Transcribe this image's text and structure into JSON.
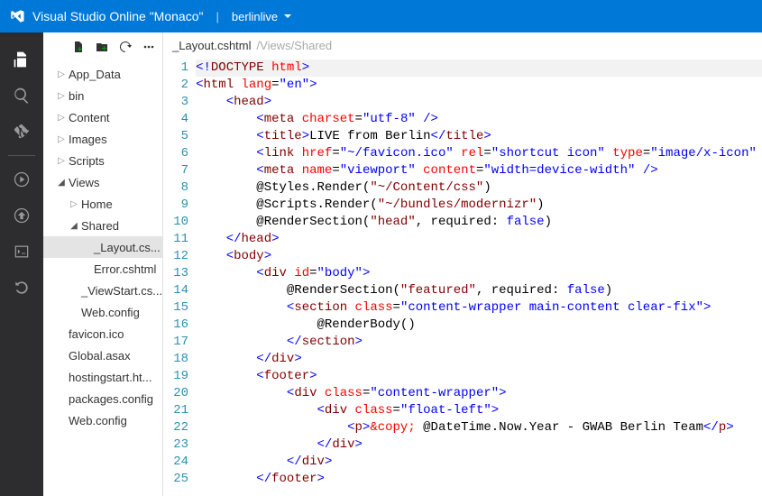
{
  "header": {
    "app_title": "Visual Studio Online \"Monaco\"",
    "project": "berlinlive"
  },
  "tree": {
    "items": [
      {
        "label": "App_Data",
        "indent": 1,
        "arrow": "closed"
      },
      {
        "label": "bin",
        "indent": 1,
        "arrow": "closed"
      },
      {
        "label": "Content",
        "indent": 1,
        "arrow": "closed"
      },
      {
        "label": "Images",
        "indent": 1,
        "arrow": "closed"
      },
      {
        "label": "Scripts",
        "indent": 1,
        "arrow": "closed"
      },
      {
        "label": "Views",
        "indent": 1,
        "arrow": "open"
      },
      {
        "label": "Home",
        "indent": 2,
        "arrow": "closed"
      },
      {
        "label": "Shared",
        "indent": 2,
        "arrow": "open"
      },
      {
        "label": "_Layout.cs...",
        "indent": 3,
        "arrow": "none",
        "selected": true
      },
      {
        "label": "Error.cshtml",
        "indent": 3,
        "arrow": "none"
      },
      {
        "label": "_ViewStart.cs...",
        "indent": 2,
        "arrow": "none"
      },
      {
        "label": "Web.config",
        "indent": 2,
        "arrow": "none"
      },
      {
        "label": "favicon.ico",
        "indent": 1,
        "arrow": "none"
      },
      {
        "label": "Global.asax",
        "indent": 1,
        "arrow": "none"
      },
      {
        "label": "hostingstart.ht...",
        "indent": 1,
        "arrow": "none"
      },
      {
        "label": "packages.config",
        "indent": 1,
        "arrow": "none"
      },
      {
        "label": "Web.config",
        "indent": 1,
        "arrow": "none"
      }
    ]
  },
  "tab": {
    "filename": "_Layout.cshtml",
    "path": "/Views/Shared"
  },
  "code": {
    "lines": [
      [
        {
          "c": "brk",
          "t": "<!"
        },
        {
          "c": "tag",
          "t": "DOCTYPE "
        },
        {
          "c": "attr",
          "t": "html"
        },
        {
          "c": "brk",
          "t": ">"
        }
      ],
      [
        {
          "c": "brk",
          "t": "<"
        },
        {
          "c": "tag",
          "t": "html "
        },
        {
          "c": "attr",
          "t": "lang"
        },
        {
          "c": "txt",
          "t": "="
        },
        {
          "c": "str",
          "t": "\"en\""
        },
        {
          "c": "brk",
          "t": ">"
        }
      ],
      [
        {
          "c": "txt",
          "t": "    "
        },
        {
          "c": "brk",
          "t": "<"
        },
        {
          "c": "tag",
          "t": "head"
        },
        {
          "c": "brk",
          "t": ">"
        }
      ],
      [
        {
          "c": "txt",
          "t": "        "
        },
        {
          "c": "brk",
          "t": "<"
        },
        {
          "c": "tag",
          "t": "meta "
        },
        {
          "c": "attr",
          "t": "charset"
        },
        {
          "c": "txt",
          "t": "="
        },
        {
          "c": "str",
          "t": "\"utf-8\""
        },
        {
          "c": "txt",
          "t": " "
        },
        {
          "c": "brk",
          "t": "/>"
        }
      ],
      [
        {
          "c": "txt",
          "t": "        "
        },
        {
          "c": "brk",
          "t": "<"
        },
        {
          "c": "tag",
          "t": "title"
        },
        {
          "c": "brk",
          "t": ">"
        },
        {
          "c": "txt",
          "t": "LIVE from Berlin"
        },
        {
          "c": "brk",
          "t": "</"
        },
        {
          "c": "tag",
          "t": "title"
        },
        {
          "c": "brk",
          "t": ">"
        }
      ],
      [
        {
          "c": "txt",
          "t": "        "
        },
        {
          "c": "brk",
          "t": "<"
        },
        {
          "c": "tag",
          "t": "link "
        },
        {
          "c": "attr",
          "t": "href"
        },
        {
          "c": "txt",
          "t": "="
        },
        {
          "c": "str",
          "t": "\"~/favicon.ico\""
        },
        {
          "c": "txt",
          "t": " "
        },
        {
          "c": "attr",
          "t": "rel"
        },
        {
          "c": "txt",
          "t": "="
        },
        {
          "c": "str",
          "t": "\"shortcut icon\""
        },
        {
          "c": "txt",
          "t": " "
        },
        {
          "c": "attr",
          "t": "type"
        },
        {
          "c": "txt",
          "t": "="
        },
        {
          "c": "str",
          "t": "\"image/x-icon\""
        },
        {
          "c": "txt",
          "t": " "
        },
        {
          "c": "brk",
          "t": "/>"
        }
      ],
      [
        {
          "c": "txt",
          "t": "        "
        },
        {
          "c": "brk",
          "t": "<"
        },
        {
          "c": "tag",
          "t": "meta "
        },
        {
          "c": "attr",
          "t": "name"
        },
        {
          "c": "txt",
          "t": "="
        },
        {
          "c": "str",
          "t": "\"viewport\""
        },
        {
          "c": "txt",
          "t": " "
        },
        {
          "c": "attr",
          "t": "content"
        },
        {
          "c": "txt",
          "t": "="
        },
        {
          "c": "str",
          "t": "\"width=device-width\""
        },
        {
          "c": "txt",
          "t": " "
        },
        {
          "c": "brk",
          "t": "/>"
        }
      ],
      [
        {
          "c": "txt",
          "t": "        @Styles.Render("
        },
        {
          "c": "tag",
          "t": "\"~/Content/css\""
        },
        {
          "c": "txt",
          "t": ")"
        }
      ],
      [
        {
          "c": "txt",
          "t": "        @Scripts.Render("
        },
        {
          "c": "tag",
          "t": "\"~/bundles/modernizr\""
        },
        {
          "c": "txt",
          "t": ")"
        }
      ],
      [
        {
          "c": "txt",
          "t": "        @RenderSection("
        },
        {
          "c": "tag",
          "t": "\"head\""
        },
        {
          "c": "txt",
          "t": ", required: "
        },
        {
          "c": "kw",
          "t": "false"
        },
        {
          "c": "txt",
          "t": ")"
        }
      ],
      [
        {
          "c": "txt",
          "t": "    "
        },
        {
          "c": "brk",
          "t": "</"
        },
        {
          "c": "tag",
          "t": "head"
        },
        {
          "c": "brk",
          "t": ">"
        }
      ],
      [
        {
          "c": "txt",
          "t": "    "
        },
        {
          "c": "brk",
          "t": "<"
        },
        {
          "c": "tag",
          "t": "body"
        },
        {
          "c": "brk",
          "t": ">"
        }
      ],
      [
        {
          "c": "txt",
          "t": "        "
        },
        {
          "c": "brk",
          "t": "<"
        },
        {
          "c": "tag",
          "t": "div "
        },
        {
          "c": "attr",
          "t": "id"
        },
        {
          "c": "txt",
          "t": "="
        },
        {
          "c": "str",
          "t": "\"body\""
        },
        {
          "c": "brk",
          "t": ">"
        }
      ],
      [
        {
          "c": "txt",
          "t": "            @RenderSection("
        },
        {
          "c": "tag",
          "t": "\"featured\""
        },
        {
          "c": "txt",
          "t": ", required: "
        },
        {
          "c": "kw",
          "t": "false"
        },
        {
          "c": "txt",
          "t": ")"
        }
      ],
      [
        {
          "c": "txt",
          "t": "            "
        },
        {
          "c": "brk",
          "t": "<"
        },
        {
          "c": "tag",
          "t": "section "
        },
        {
          "c": "attr",
          "t": "class"
        },
        {
          "c": "txt",
          "t": "="
        },
        {
          "c": "str",
          "t": "\"content-wrapper main-content clear-fix\""
        },
        {
          "c": "brk",
          "t": ">"
        }
      ],
      [
        {
          "c": "txt",
          "t": "                @RenderBody()"
        }
      ],
      [
        {
          "c": "txt",
          "t": "            "
        },
        {
          "c": "brk",
          "t": "</"
        },
        {
          "c": "tag",
          "t": "section"
        },
        {
          "c": "brk",
          "t": ">"
        }
      ],
      [
        {
          "c": "txt",
          "t": "        "
        },
        {
          "c": "brk",
          "t": "</"
        },
        {
          "c": "tag",
          "t": "div"
        },
        {
          "c": "brk",
          "t": ">"
        }
      ],
      [
        {
          "c": "txt",
          "t": "        "
        },
        {
          "c": "brk",
          "t": "<"
        },
        {
          "c": "tag",
          "t": "footer"
        },
        {
          "c": "brk",
          "t": ">"
        }
      ],
      [
        {
          "c": "txt",
          "t": "            "
        },
        {
          "c": "brk",
          "t": "<"
        },
        {
          "c": "tag",
          "t": "div "
        },
        {
          "c": "attr",
          "t": "class"
        },
        {
          "c": "txt",
          "t": "="
        },
        {
          "c": "str",
          "t": "\"content-wrapper\""
        },
        {
          "c": "brk",
          "t": ">"
        }
      ],
      [
        {
          "c": "txt",
          "t": "                "
        },
        {
          "c": "brk",
          "t": "<"
        },
        {
          "c": "tag",
          "t": "div "
        },
        {
          "c": "attr",
          "t": "class"
        },
        {
          "c": "txt",
          "t": "="
        },
        {
          "c": "str",
          "t": "\"float-left\""
        },
        {
          "c": "brk",
          "t": ">"
        }
      ],
      [
        {
          "c": "txt",
          "t": "                    "
        },
        {
          "c": "brk",
          "t": "<"
        },
        {
          "c": "tag",
          "t": "p"
        },
        {
          "c": "brk",
          "t": ">"
        },
        {
          "c": "attr",
          "t": "&copy;"
        },
        {
          "c": "txt",
          "t": " @DateTime.Now.Year - GWAB Berlin Team"
        },
        {
          "c": "brk",
          "t": "</"
        },
        {
          "c": "tag",
          "t": "p"
        },
        {
          "c": "brk",
          "t": ">"
        }
      ],
      [
        {
          "c": "txt",
          "t": "                "
        },
        {
          "c": "brk",
          "t": "</"
        },
        {
          "c": "tag",
          "t": "div"
        },
        {
          "c": "brk",
          "t": ">"
        }
      ],
      [
        {
          "c": "txt",
          "t": "            "
        },
        {
          "c": "brk",
          "t": "</"
        },
        {
          "c": "tag",
          "t": "div"
        },
        {
          "c": "brk",
          "t": ">"
        }
      ],
      [
        {
          "c": "txt",
          "t": "        "
        },
        {
          "c": "brk",
          "t": "</"
        },
        {
          "c": "tag",
          "t": "footer"
        },
        {
          "c": "brk",
          "t": ">"
        }
      ]
    ]
  }
}
